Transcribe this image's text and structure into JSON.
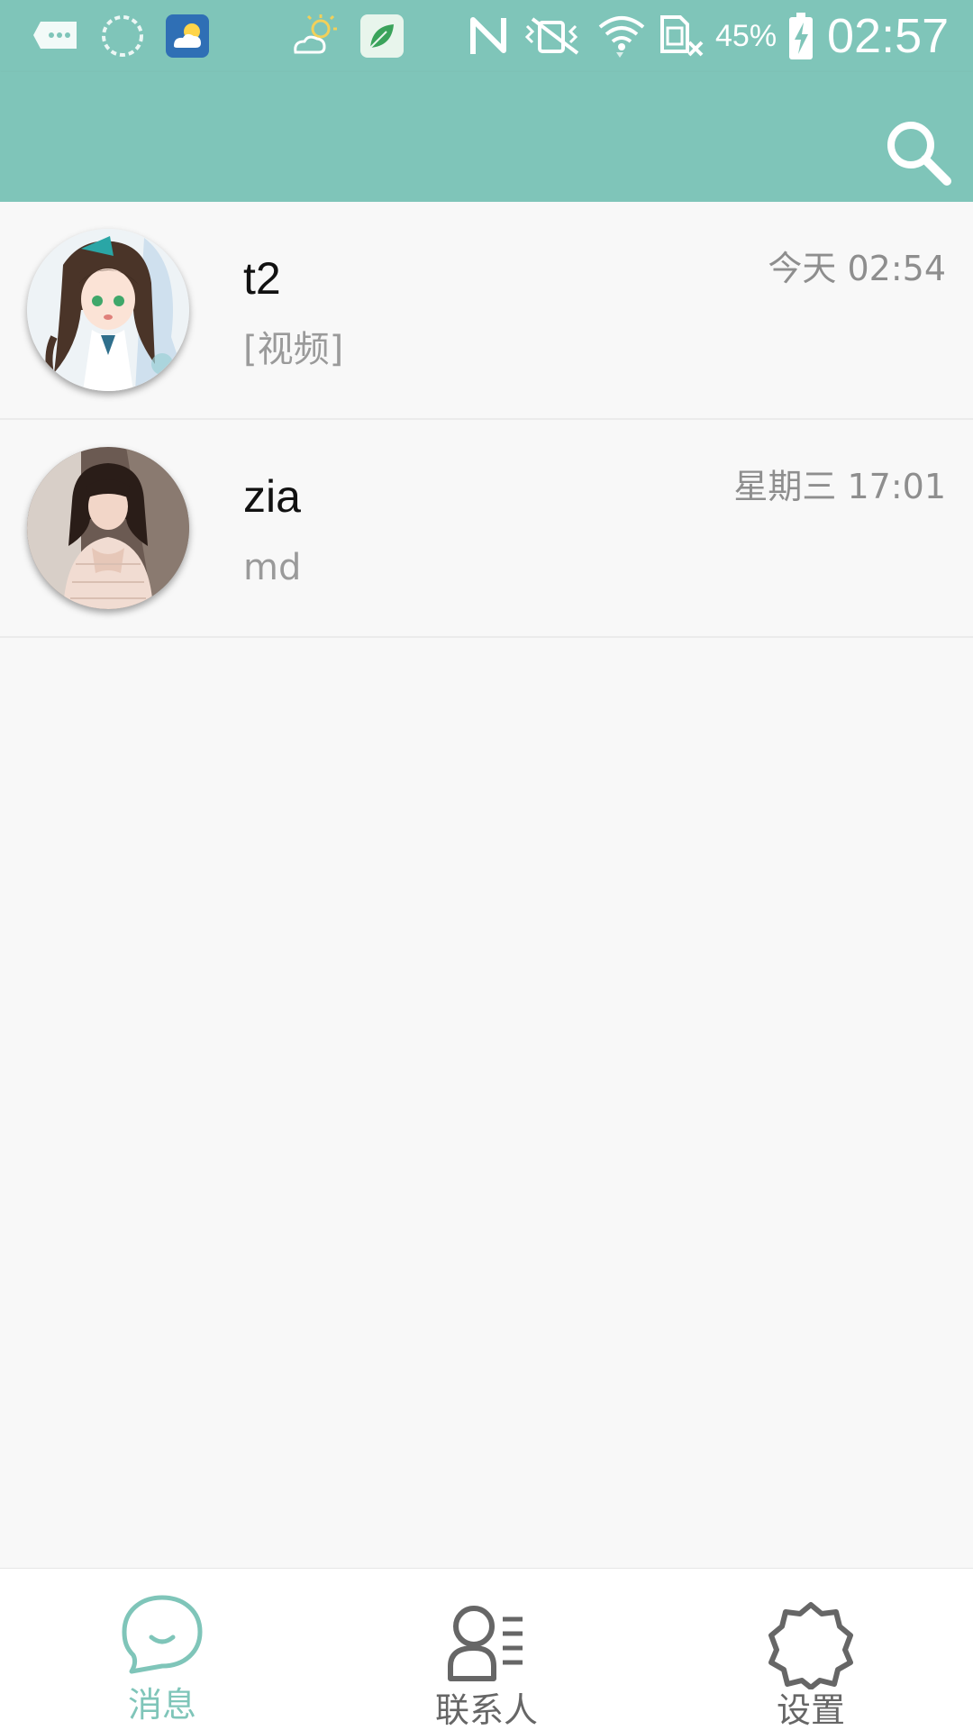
{
  "colors": {
    "accent": "#7fc5b9",
    "nav_active": "#7fc5b9",
    "nav_inactive": "#666666"
  },
  "status_bar": {
    "icons": [
      "message-notification-icon",
      "loading-ring-icon",
      "weather-app-icon",
      "sunny-cloudy-icon",
      "app-leaf-icon",
      "nfc-icon",
      "vibrate-mute-icon",
      "wifi-icon",
      "no-sim-icon",
      "battery-charging-icon"
    ],
    "battery_percent": "45%",
    "time": "02:57"
  },
  "app_bar": {
    "search_icon": "search-icon"
  },
  "conversations": [
    {
      "name": "t2",
      "time": "今天 02:54",
      "preview": "[视频]",
      "avatar": "anime-girl-avatar"
    },
    {
      "name": "zia",
      "time": "星期三 17:01",
      "preview": "md",
      "avatar": "photo-girl-avatar"
    }
  ],
  "bottom_nav": {
    "tabs": [
      {
        "label": "消息",
        "icon": "chat-bubble-icon",
        "active": true
      },
      {
        "label": "联系人",
        "icon": "contacts-icon",
        "active": false
      },
      {
        "label": "设置",
        "icon": "settings-gear-icon",
        "active": false
      }
    ]
  }
}
